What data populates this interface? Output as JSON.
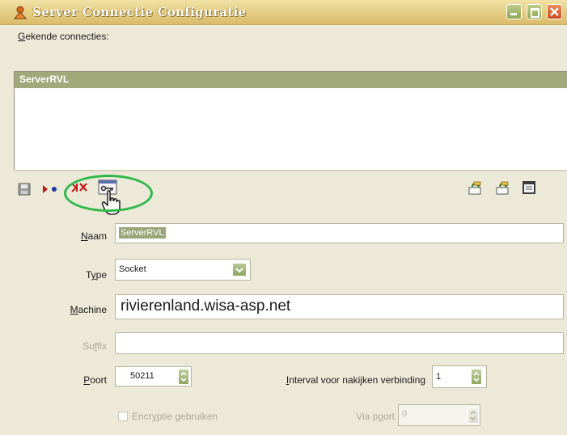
{
  "window": {
    "title": "Server Connectie Configuratie",
    "controls": [
      "minimize-icon",
      "maximize-icon",
      "close-icon"
    ]
  },
  "connections": {
    "label": "Gekende connecties:",
    "label_accel": "G",
    "label_rest": "ekende connecties:",
    "items": [
      {
        "label": "ServerRVL",
        "selected": true
      }
    ]
  },
  "toolbar": {
    "left_icons": [
      "save-icon",
      "connect-icon",
      "disconnect-icon",
      "key-settings-icon"
    ],
    "right_icons": [
      "import-icon",
      "export-icon",
      "properties-icon"
    ]
  },
  "form": {
    "naam": {
      "label_accel": "N",
      "label_rest": "aam",
      "value": "ServerRVL"
    },
    "type": {
      "label_pre": "T",
      "label_accel": "y",
      "label_rest": "pe",
      "value": "Socket"
    },
    "machine": {
      "label_accel": "M",
      "label_rest": "achine",
      "value": "rivierenland.wisa-asp.net"
    },
    "suffix": {
      "label_pre": "Su",
      "label_accel": "f",
      "label_rest": "fix",
      "value": ""
    },
    "poort": {
      "label_accel": "P",
      "label_rest": "oort",
      "value": "50211"
    },
    "interval": {
      "label_accel": "I",
      "label_rest": "nterval voor nakijken verbinding",
      "value": "1"
    },
    "encryptie": {
      "label_pre": "Encr",
      "label_accel": "y",
      "label_rest": "ptie gebruiken",
      "checked": false
    },
    "via_poort": {
      "label_pre": "Via p",
      "label_accel": "o",
      "label_rest": "ort",
      "value": "0"
    }
  },
  "colors": {
    "titlebar": "#e6cf86",
    "selection": "#a1a97a",
    "highlight": "#2fb84a",
    "close_button": "#cc4b22"
  }
}
